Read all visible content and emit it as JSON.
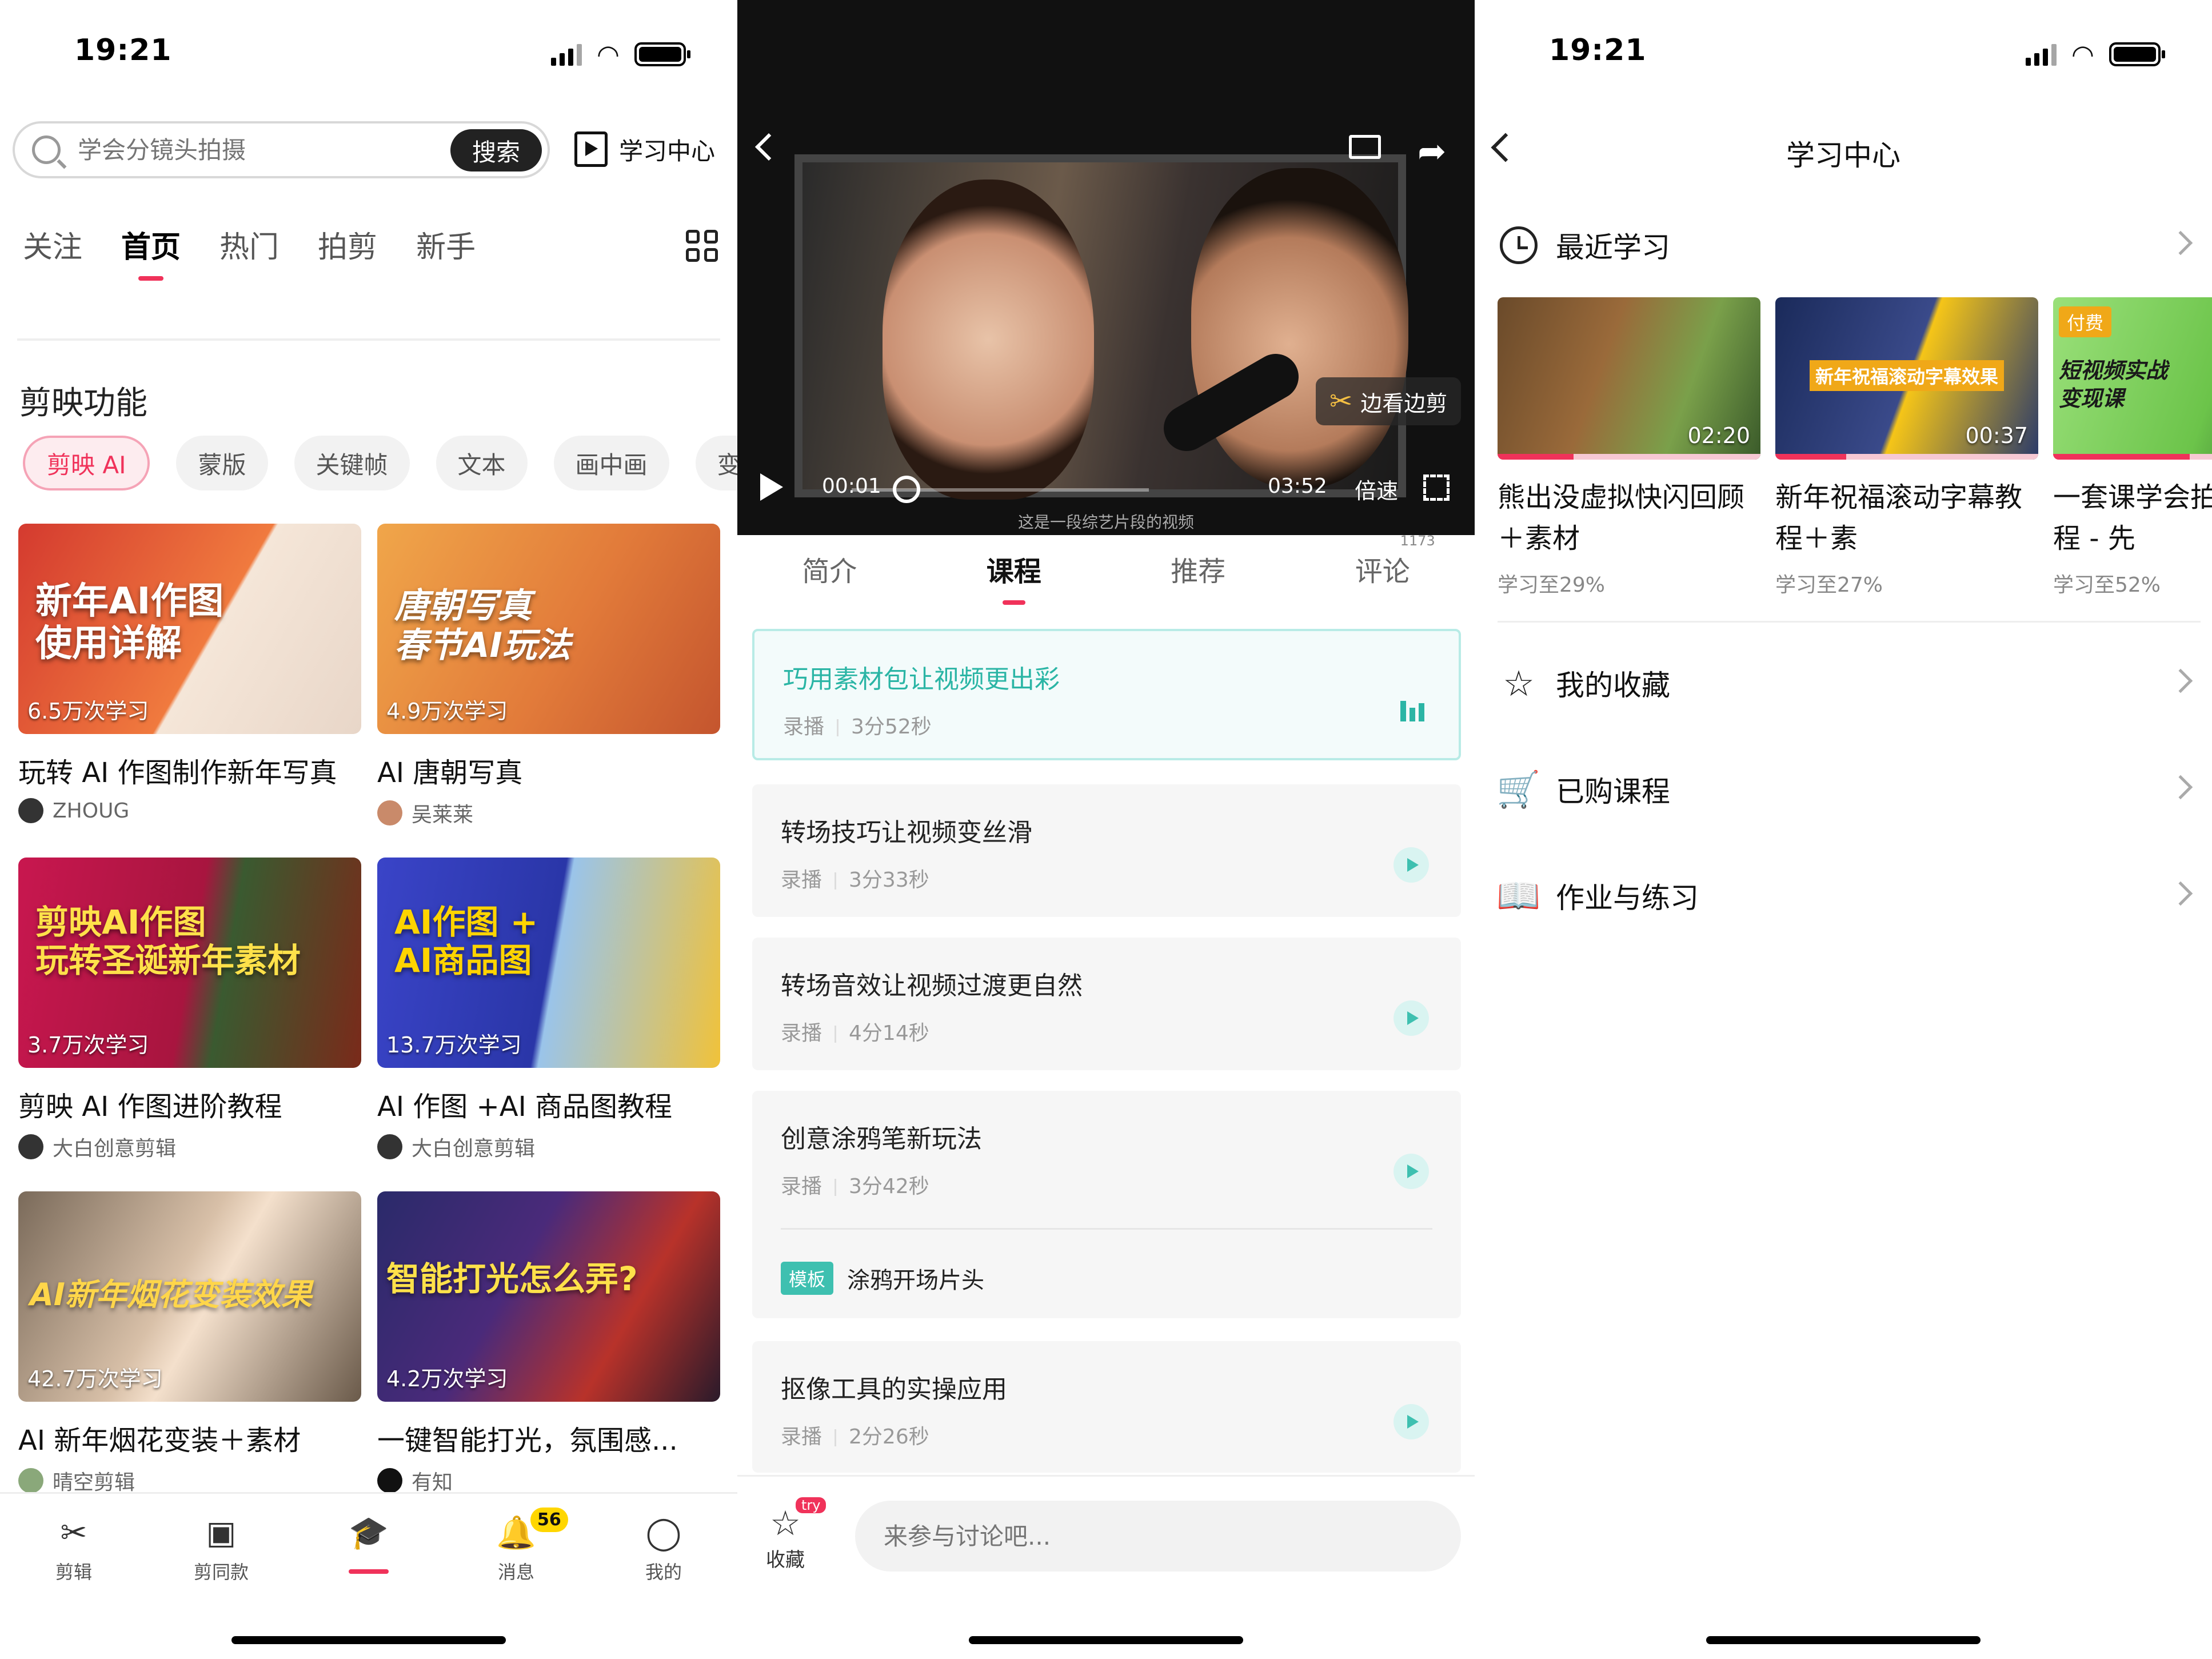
{
  "status": {
    "time": "19:21"
  },
  "home": {
    "search": {
      "placeholder": "学会分镜头拍摄",
      "button": "搜索"
    },
    "study_center": "学习中心",
    "nav_tabs": [
      "关注",
      "首页",
      "热门",
      "拍剪",
      "新手"
    ],
    "section_title": "剪映功能",
    "chips": [
      "剪映 AI",
      "蒙版",
      "关键帧",
      "文本",
      "画中画",
      "变"
    ],
    "cards": [
      {
        "thumb_text": "新年AI作图\n使用详解",
        "views": "6.5万次学习",
        "title": "玩转 AI 作图制作新年写真",
        "author": "ZHOUG"
      },
      {
        "thumb_text": "唐朝写真\n春节AI玩法",
        "views": "4.9万次学习",
        "title": "AI 唐朝写真",
        "author": "吴莱莱"
      },
      {
        "thumb_text": "剪映AI作图\n玩转圣诞新年素材",
        "views": "3.7万次学习",
        "title": "剪映 AI 作图进阶教程",
        "author": "大白创意剪辑"
      },
      {
        "thumb_text": "AI作图 +\nAI商品图",
        "views": "13.7万次学习",
        "title": "AI 作图 +AI 商品图教程",
        "author": "大白创意剪辑"
      },
      {
        "thumb_text": "AI新年烟花变装效果",
        "views": "42.7万次学习",
        "title": "AI 新年烟花变装＋素材",
        "author": "晴空剪辑"
      },
      {
        "thumb_text": "智能打光怎么弄?",
        "views": "4.2万次学习",
        "title": "一键智能打光，氛围感...",
        "author": "有知"
      }
    ],
    "tabbar": [
      {
        "label": "剪辑",
        "icon": "scissors-icon"
      },
      {
        "label": "剪同款",
        "icon": "template-icon"
      },
      {
        "label": "",
        "icon": "graduation-cap-icon"
      },
      {
        "label": "消息",
        "icon": "bell-icon",
        "badge": "56"
      },
      {
        "label": "我的",
        "icon": "person-icon"
      }
    ]
  },
  "player": {
    "edit_button": "边看边剪",
    "current_time": "00:01",
    "duration": "03:52",
    "speed": "倍速",
    "caption": "这是一段综艺片段的视频",
    "progress": 0.005,
    "tabs": [
      "简介",
      "课程",
      "推荐",
      "评论"
    ],
    "comment_count": "1173",
    "lessons": [
      {
        "title": "巧用素材包让视频更出彩",
        "type": "录播",
        "duration": "3分52秒",
        "playing": true
      },
      {
        "title": "转场技巧让视频变丝滑",
        "type": "录播",
        "duration": "3分33秒"
      },
      {
        "title": "转场音效让视频过渡更自然",
        "type": "录播",
        "duration": "4分14秒"
      },
      {
        "title": "创意涂鸦笔新玩法",
        "type": "录播",
        "duration": "3分42秒",
        "template_tag": "模板",
        "template_name": "涂鸦开场片头"
      },
      {
        "title": "抠像工具的实操应用",
        "type": "录播",
        "duration": "2分26秒"
      }
    ],
    "favorite_label": "收藏",
    "try_tag": "try",
    "comment_placeholder": "来参与讨论吧..."
  },
  "learning_center": {
    "title": "学习中心",
    "recent_label": "最近学习",
    "recent": [
      {
        "title": "熊出没虚拟快闪回顾＋素材",
        "progress_text": "学习至29%",
        "progress": 0.29,
        "duration": "02:20"
      },
      {
        "title": "新年祝福滚动字幕教程＋素",
        "progress_text": "学习至27%",
        "progress": 0.27,
        "duration": "00:37",
        "thumb_text": "新年祝福滚动字幕效果"
      },
      {
        "title": "一套课学会拍辑全流程 - 先",
        "progress_text": "学习至52%",
        "progress": 0.52,
        "badge": "付费",
        "thumb_text": "短视频实战变现课"
      }
    ],
    "menu": [
      "我的收藏",
      "已购课程",
      "作业与练习"
    ]
  },
  "colors": {
    "accent": "#f0325a",
    "teal": "#2bb5a5",
    "badge_yellow": "#ffd600"
  }
}
